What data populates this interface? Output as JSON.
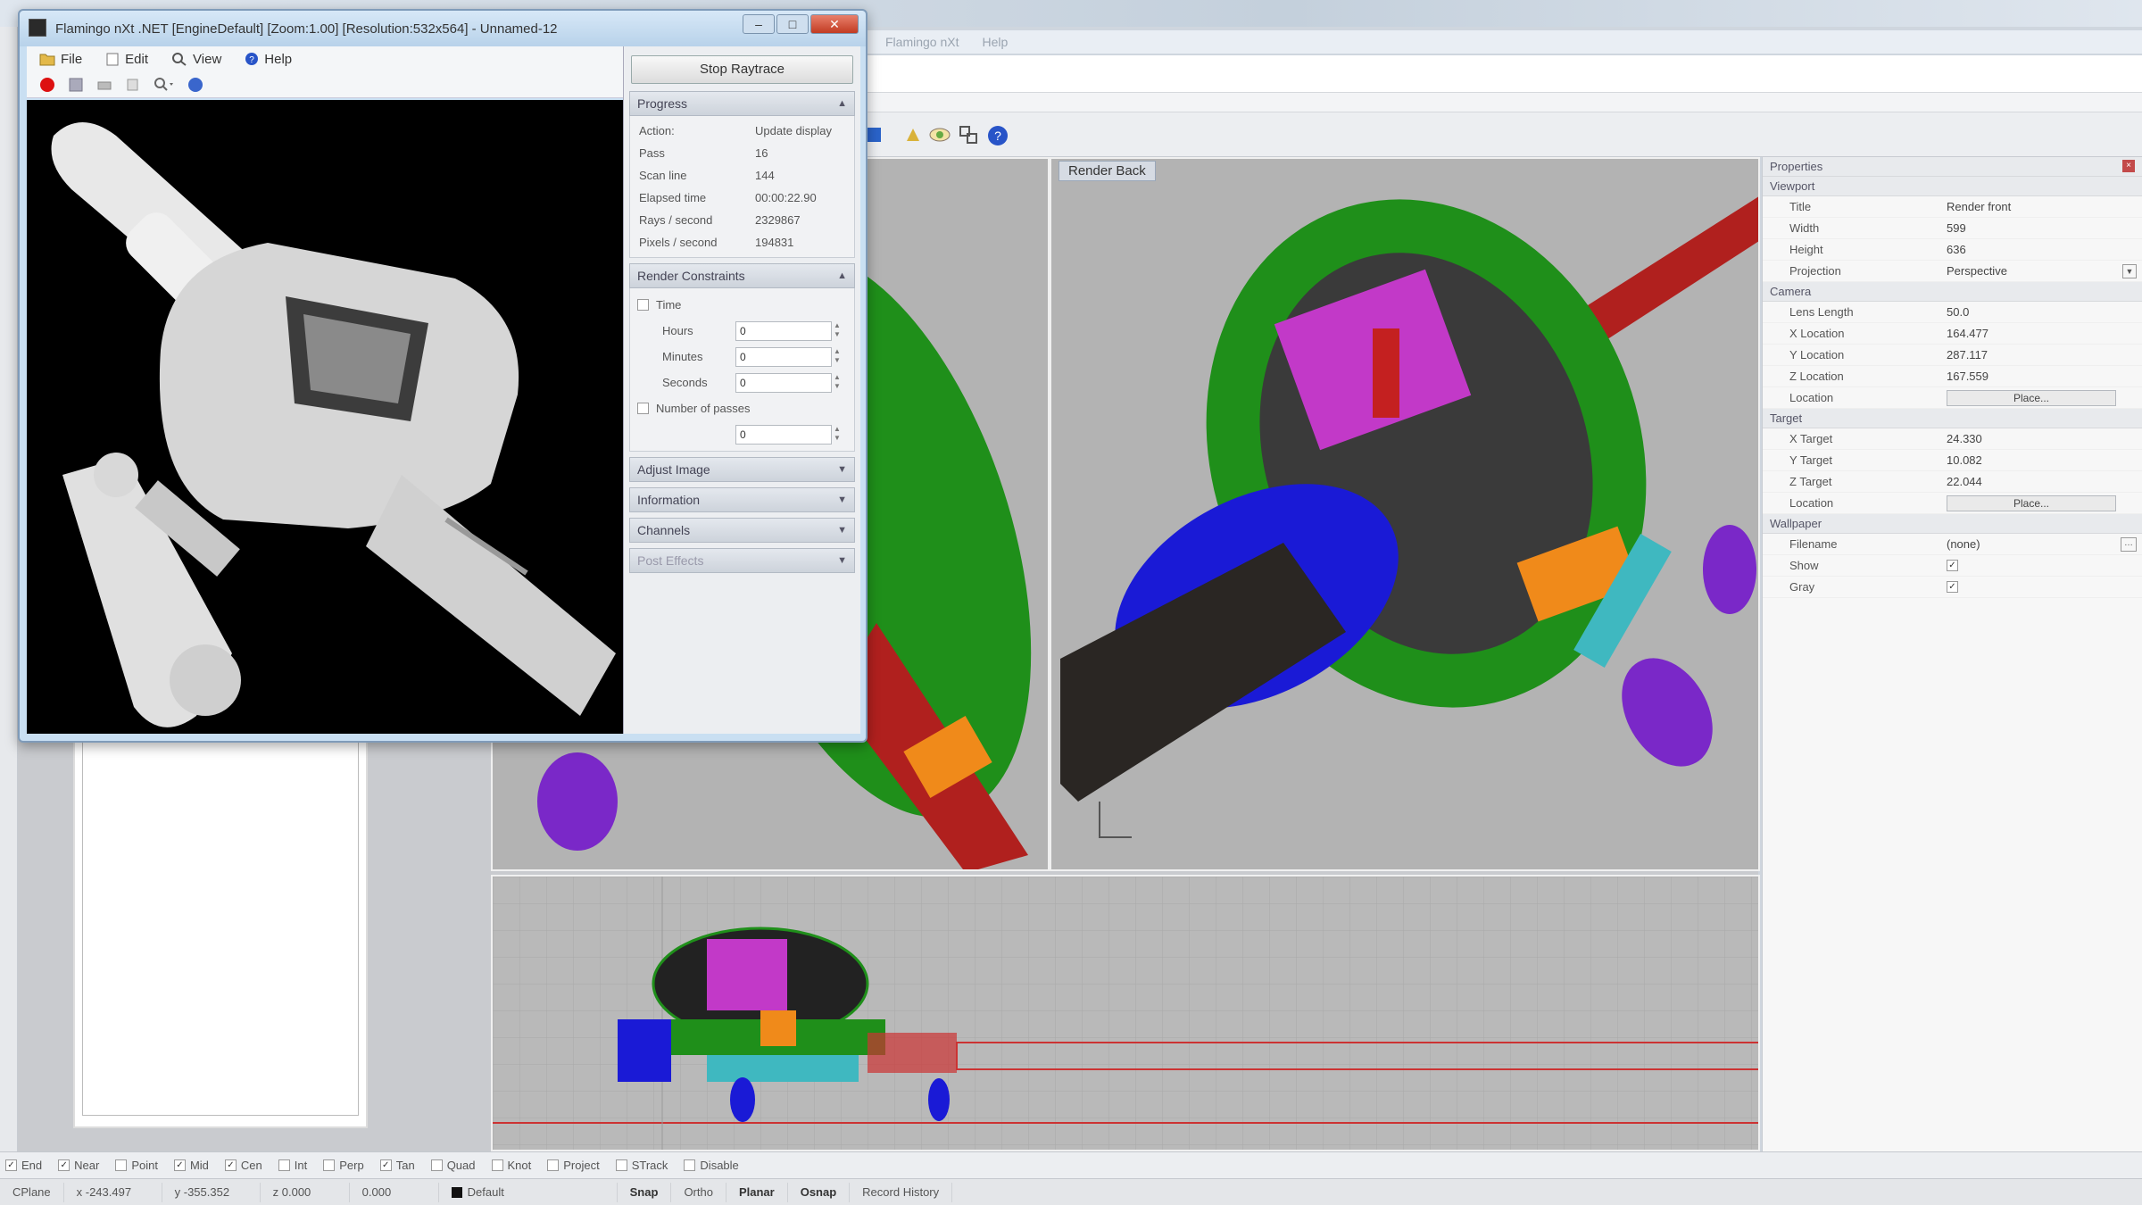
{
  "rhino": {
    "title_items": [
      "Flamingo nXt",
      "Help"
    ],
    "viewport_label": "Render Back"
  },
  "flamingo": {
    "title": "Flamingo nXt .NET [EngineDefault] [Zoom:1.00] [Resolution:532x564] - Unnamed-12",
    "menu": [
      {
        "label": "File",
        "icon": "folder-icon"
      },
      {
        "label": "Edit",
        "icon": "edit-icon"
      },
      {
        "label": "View",
        "icon": "view-icon"
      },
      {
        "label": "Help",
        "icon": "help-icon"
      }
    ],
    "stop_button": "Stop Raytrace",
    "progress": {
      "title": "Progress",
      "rows": [
        {
          "k": "Action:",
          "v": "Update display"
        },
        {
          "k": "Pass",
          "v": "16"
        },
        {
          "k": "Scan line",
          "v": "144"
        },
        {
          "k": "Elapsed time",
          "v": "00:00:22.90"
        },
        {
          "k": "Rays / second",
          "v": "2329867"
        },
        {
          "k": "Pixels / second",
          "v": "194831"
        }
      ]
    },
    "constraints": {
      "title": "Render Constraints",
      "time_label": "Time",
      "hours_label": "Hours",
      "minutes_label": "Minutes",
      "seconds_label": "Seconds",
      "hours_value": "0",
      "minutes_value": "0",
      "seconds_value": "0",
      "passes_label": "Number of passes",
      "passes_value": "0"
    },
    "sections": [
      "Adjust Image",
      "Information",
      "Channels",
      "Post Effects"
    ]
  },
  "properties": {
    "header": "Properties",
    "viewport_header": "Viewport",
    "viewport_rows": [
      {
        "k": "Title",
        "v": "Render front"
      },
      {
        "k": "Width",
        "v": "599"
      },
      {
        "k": "Height",
        "v": "636"
      },
      {
        "k": "Projection",
        "v": "Perspective"
      }
    ],
    "camera_header": "Camera",
    "camera_rows": [
      {
        "k": "Lens Length",
        "v": "50.0"
      },
      {
        "k": "X Location",
        "v": "164.477"
      },
      {
        "k": "Y Location",
        "v": "287.117"
      },
      {
        "k": "Z Location",
        "v": "167.559"
      }
    ],
    "location_label": "Location",
    "place_label": "Place...",
    "target_header": "Target",
    "target_rows": [
      {
        "k": "X Target",
        "v": "24.330"
      },
      {
        "k": "Y Target",
        "v": "10.082"
      },
      {
        "k": "Z Target",
        "v": "22.044"
      }
    ],
    "wallpaper_header": "Wallpaper",
    "filename_label": "Filename",
    "filename_value": "(none)",
    "show_label": "Show",
    "gray_label": "Gray"
  },
  "osnap": [
    {
      "label": "End",
      "checked": true
    },
    {
      "label": "Near",
      "checked": true
    },
    {
      "label": "Point",
      "checked": false
    },
    {
      "label": "Mid",
      "checked": true
    },
    {
      "label": "Cen",
      "checked": true
    },
    {
      "label": "Int",
      "checked": false
    },
    {
      "label": "Perp",
      "checked": false
    },
    {
      "label": "Tan",
      "checked": true
    },
    {
      "label": "Quad",
      "checked": false
    },
    {
      "label": "Knot",
      "checked": false
    },
    {
      "label": "Project",
      "checked": false
    },
    {
      "label": "STrack",
      "checked": false
    },
    {
      "label": "Disable",
      "checked": false
    }
  ],
  "status": {
    "cplane": "CPlane",
    "x": "x -243.497",
    "y": "y -355.352",
    "z": "z 0.000",
    "extra": "0.000",
    "layer": "Default",
    "toggles": [
      "Snap",
      "Ortho",
      "Planar",
      "Osnap",
      "Record History"
    ]
  },
  "colors": {
    "green": "#1f8f1a",
    "blue": "#1a1ad6",
    "magenta": "#c239c8",
    "orange": "#f08a1a",
    "red": "#b0201e",
    "purple": "#7a28c8"
  }
}
